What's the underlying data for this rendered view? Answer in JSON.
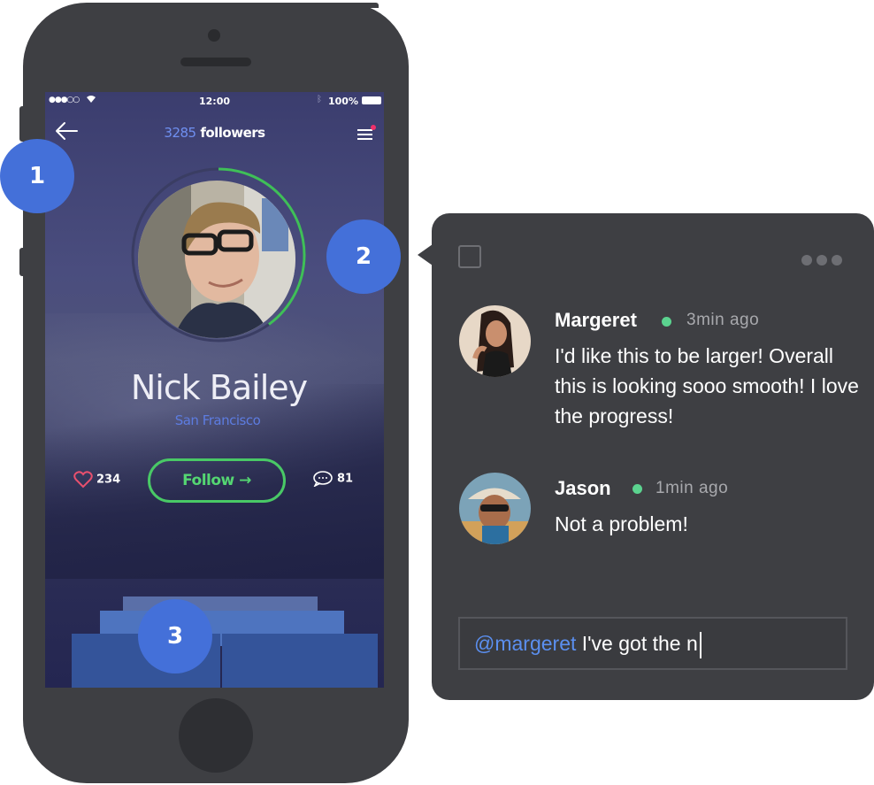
{
  "status_bar": {
    "signal": "●●●○○",
    "time": "12:00",
    "battery": "100%"
  },
  "profile_header": {
    "followers_count": "3285",
    "followers_label": " followers"
  },
  "profile": {
    "name": "Nick Bailey",
    "city": "San Francisco",
    "likes": "234",
    "follow_label": "Follow →",
    "comments": "81",
    "progress_ring_fraction": 0.4
  },
  "badges": [
    "1",
    "2",
    "3"
  ],
  "comments": [
    {
      "author": "Margeret",
      "time": "3min ago",
      "text": "I'd like this to be larger! Overall this is looking sooo smooth! I love the progress!"
    },
    {
      "author": "Jason",
      "time": "1min ago",
      "text": "Not a problem!"
    }
  ],
  "reply": {
    "mention": "@margeret",
    "text": " I've got the n"
  },
  "colors": {
    "accent_blue": "#4470d9",
    "follow_green": "#49c966",
    "online_green": "#5bd38f",
    "mention_blue": "#5b8ff0",
    "dark_panel": "#3e3f43"
  }
}
